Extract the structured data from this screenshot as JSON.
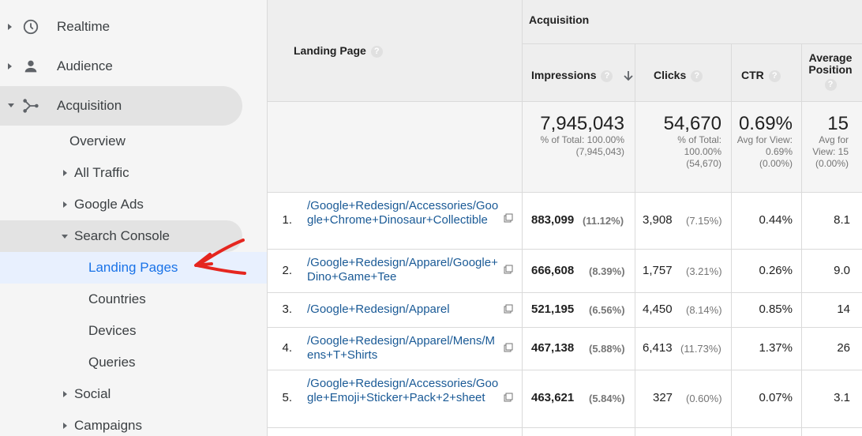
{
  "sidebar": {
    "top_items": [
      {
        "label": "Realtime",
        "icon": "clock-icon"
      },
      {
        "label": "Audience",
        "icon": "person-icon"
      },
      {
        "label": "Acquisition",
        "icon": "acquisition-icon"
      }
    ],
    "sub_items": [
      {
        "label": "Overview"
      },
      {
        "label": "All Traffic"
      },
      {
        "label": "Google Ads"
      },
      {
        "label": "Search Console"
      },
      {
        "label": "Landing Pages"
      },
      {
        "label": "Countries"
      },
      {
        "label": "Devices"
      },
      {
        "label": "Queries"
      },
      {
        "label": "Social"
      },
      {
        "label": "Campaigns"
      }
    ],
    "selected": "Landing Pages",
    "accent_color": "#1a73e8",
    "arrow_color": "#e5261f"
  },
  "table": {
    "group_header": "Acquisition",
    "dim_header": "Landing Page",
    "help_glyph": "?",
    "columns": {
      "impressions": "Impressions",
      "clicks": "Clicks",
      "ctr": "CTR",
      "avg_position": "Average Position"
    },
    "sort_icon": "sort-down-arrow-icon",
    "totals": {
      "impressions": "7,945,043",
      "impressions_sub": "% of Total: 100.00% (7,945,043)",
      "clicks": "54,670",
      "clicks_sub": "% of Total: 100.00% (54,670)",
      "ctr": "0.69%",
      "ctr_sub": "Avg for View: 0.69% (0.00%)",
      "position": "15",
      "position_sub": "Avg for View: 15 (0.00%)"
    },
    "rows": [
      {
        "num": "1.",
        "page": "/Google+Redesign/Accessories/Google+Chrome+Dinosaur+Collectible",
        "impressions": "883,099",
        "imp_pct": "(11.12%)",
        "clicks": "3,908",
        "clk_pct": "(7.15%)",
        "ctr": "0.44%",
        "position": "8.1"
      },
      {
        "num": "2.",
        "page": "/Google+Redesign/Apparel/Google+Dino+Game+Tee",
        "impressions": "666,608",
        "imp_pct": "(8.39%)",
        "clicks": "1,757",
        "clk_pct": "(3.21%)",
        "ctr": "0.26%",
        "position": "9.0"
      },
      {
        "num": "3.",
        "page": "/Google+Redesign/Apparel",
        "impressions": "521,195",
        "imp_pct": "(6.56%)",
        "clicks": "4,450",
        "clk_pct": "(8.14%)",
        "ctr": "0.85%",
        "position": "14"
      },
      {
        "num": "4.",
        "page": "/Google+Redesign/Apparel/Mens/Mens+T+Shirts",
        "impressions": "467,138",
        "imp_pct": "(5.88%)",
        "clicks": "6,413",
        "clk_pct": "(11.73%)",
        "ctr": "1.37%",
        "position": "26"
      },
      {
        "num": "5.",
        "page": "/Google+Redesign/Accessories/Google+Emoji+Sticker+Pack+2+sheet",
        "impressions": "463,621",
        "imp_pct": "(5.84%)",
        "clicks": "327",
        "clk_pct": "(0.60%)",
        "ctr": "0.07%",
        "position": "3.1"
      }
    ]
  }
}
